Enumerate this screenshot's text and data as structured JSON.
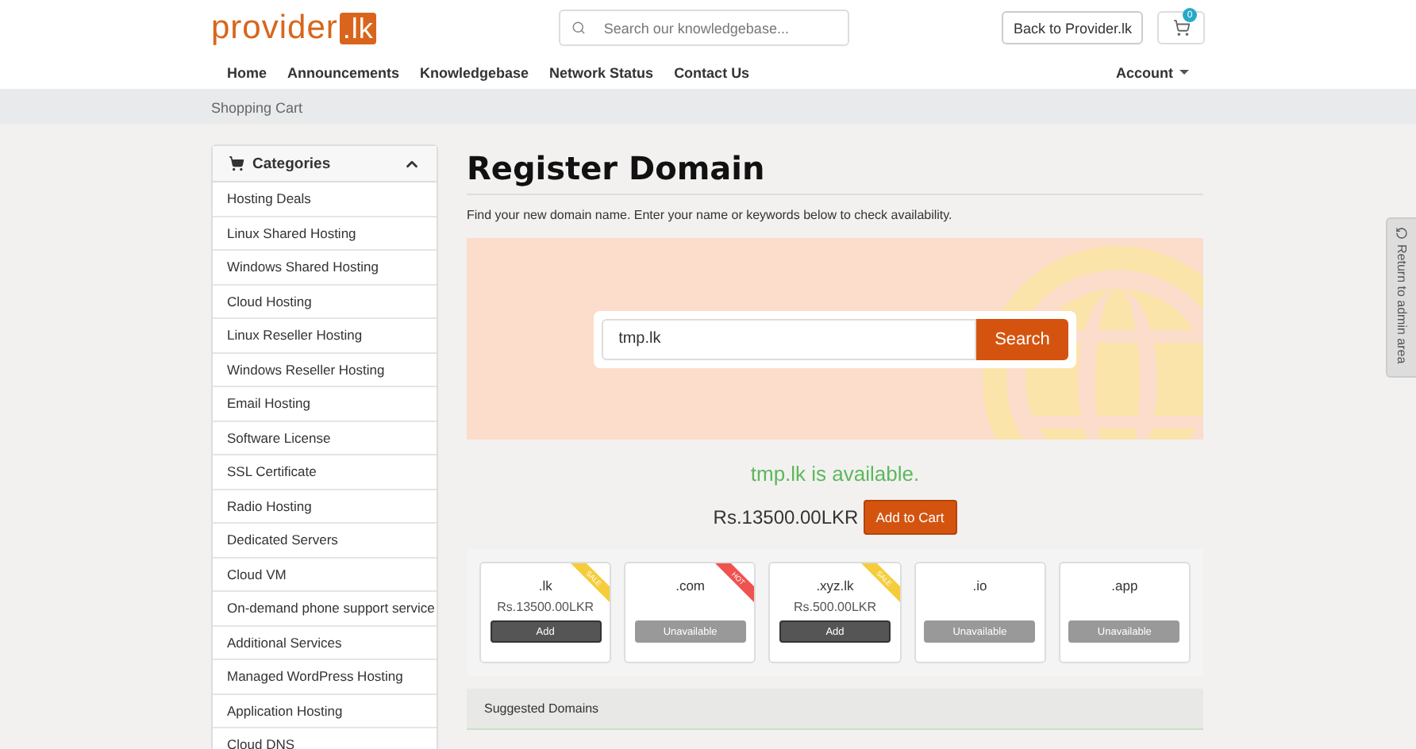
{
  "header": {
    "logo": {
      "text": "provider",
      "accent": ".lk"
    },
    "search": {
      "placeholder": "Search our knowledgebase..."
    },
    "back_button": "Back to Provider.lk",
    "cart_count": "0"
  },
  "nav": {
    "items": [
      "Home",
      "Announcements",
      "Knowledgebase",
      "Network Status",
      "Contact Us"
    ],
    "account": "Account"
  },
  "breadcrumb": "Shopping Cart",
  "sidebar": {
    "title": "Categories",
    "expanded": true,
    "items": [
      {
        "label": "Hosting Deals"
      },
      {
        "label": "Linux Shared Hosting"
      },
      {
        "label": "Windows Shared Hosting"
      },
      {
        "label": "Cloud Hosting"
      },
      {
        "label": "Linux Reseller Hosting"
      },
      {
        "label": "Windows Reseller Hosting"
      },
      {
        "label": "Email Hosting"
      },
      {
        "label": "Software License"
      },
      {
        "label": "SSL Certificate"
      },
      {
        "label": "Radio Hosting"
      },
      {
        "label": "Dedicated Servers"
      },
      {
        "label": "Cloud VM"
      },
      {
        "label": "On-demand phone support service"
      },
      {
        "label": "Additional Services"
      },
      {
        "label": "Managed WordPress Hosting"
      },
      {
        "label": "Application Hosting"
      },
      {
        "label": "Cloud DNS"
      }
    ]
  },
  "main": {
    "title": "Register Domain",
    "intro": "Find your new domain name. Enter your name or keywords below to check availability.",
    "search": {
      "value": "tmp.lk",
      "button": "Search"
    },
    "result": {
      "message": "tmp.lk is available.",
      "price": "Rs.13500.00LKR",
      "button": "Add to Cart"
    },
    "tlds": [
      {
        "tld": ".lk",
        "price": "Rs.13500.00LKR",
        "available": true,
        "button": "Add",
        "ribbon": {
          "label": "SALE",
          "color": "#f5cd3c"
        }
      },
      {
        "tld": ".com",
        "available": false,
        "button": "Unavailable",
        "ribbon": {
          "label": "HOT",
          "color": "#ef5350"
        }
      },
      {
        "tld": ".xyz.lk",
        "price": "Rs.500.00LKR",
        "available": true,
        "button": "Add",
        "ribbon": {
          "label": "SALE",
          "color": "#f5cd3c"
        }
      },
      {
        "tld": ".io",
        "available": false,
        "button": "Unavailable"
      },
      {
        "tld": ".app",
        "available": false,
        "button": "Unavailable"
      }
    ],
    "suggested_title": "Suggested Domains"
  },
  "side_tab": "Return to admin area"
}
